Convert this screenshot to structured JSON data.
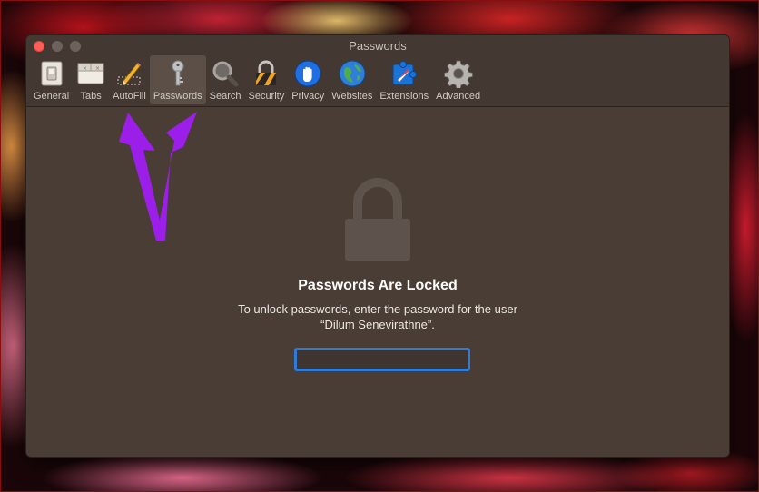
{
  "window": {
    "title": "Passwords"
  },
  "toolbar": {
    "items": [
      {
        "label": "General",
        "icon": "general-switch-icon"
      },
      {
        "label": "Tabs",
        "icon": "tabs-window-icon"
      },
      {
        "label": "AutoFill",
        "icon": "pencil-form-icon"
      },
      {
        "label": "Passwords",
        "icon": "key-icon",
        "selected": true
      },
      {
        "label": "Search",
        "icon": "magnifier-icon"
      },
      {
        "label": "Security",
        "icon": "padlock-hazard-icon"
      },
      {
        "label": "Privacy",
        "icon": "privacy-hand-icon"
      },
      {
        "label": "Websites",
        "icon": "globe-icon"
      },
      {
        "label": "Extensions",
        "icon": "puzzle-compass-icon"
      },
      {
        "label": "Advanced",
        "icon": "gear-icon"
      }
    ]
  },
  "locked": {
    "title": "Passwords Are Locked",
    "description": "To unlock passwords, enter the password for the user “Dilum Senevirathne”.",
    "password_value": ""
  },
  "colors": {
    "window_bg": "#4a3d36",
    "selected_tab": "#5b4f48",
    "focus_ring": "#2f7bd6",
    "annotation_arrow": "#9b1fe8"
  }
}
